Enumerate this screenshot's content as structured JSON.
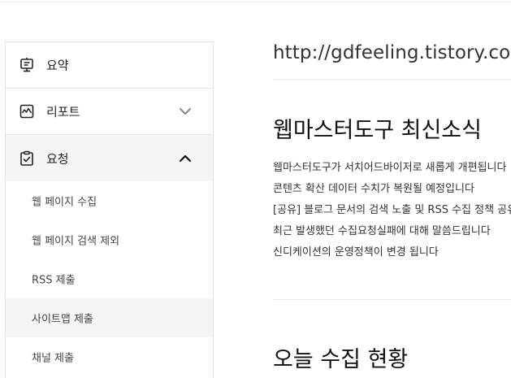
{
  "sidebar": {
    "items": [
      {
        "label": "요약",
        "icon": "summary-icon"
      },
      {
        "label": "리포트",
        "icon": "report-icon",
        "expanded": false
      },
      {
        "label": "요청",
        "icon": "request-icon",
        "expanded": true
      }
    ],
    "submenu": [
      {
        "label": "웹 페이지 수집"
      },
      {
        "label": "웹 페이지 검색 제외"
      },
      {
        "label": "RSS 제출"
      },
      {
        "label": "사이트맵 제출",
        "selected": true
      },
      {
        "label": "채널 제출"
      }
    ]
  },
  "main": {
    "site_url": "http://gdfeeling.tistory.com",
    "news_title": "웹마스터도구 최신소식",
    "news": [
      "웹마스터도구가 서치어드바이저로 새롭게 개편됩니다",
      "콘텐츠 확산 데이터 수치가 복원될 예정입니다",
      "[공유] 블로그 문서의 검색 노출 및 RSS 수집 정책 공유",
      "최근 발생했던 수집요청실패에 대해 말씀드립니다",
      "신디케이션의 운영정책이 변경 됩니다"
    ],
    "today_title": "오늘 수집 현황"
  },
  "colors": {
    "active_bg": "#f5f5f5",
    "border": "#e3e3e3",
    "text": "#222222"
  }
}
